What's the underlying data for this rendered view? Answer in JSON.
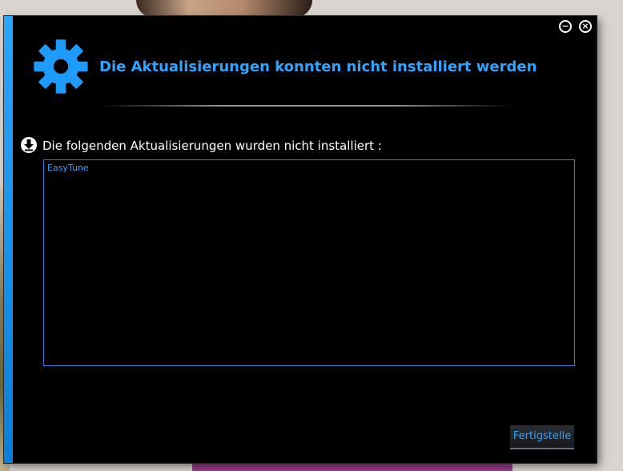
{
  "window": {
    "title": "Die Aktualisierungen konnten nicht installiert werden",
    "minimize_icon": "minimize-icon",
    "close_icon": "close-icon",
    "gear_icon": "gear-icon",
    "accent_color": "#2ea4ff"
  },
  "section": {
    "heading": "Die folgenden Aktualisierungen wurden nicht installiert :",
    "icon": "download-icon"
  },
  "list": {
    "items": [
      "EasyTune"
    ]
  },
  "footer": {
    "finish_label": "Fertigstelle"
  }
}
